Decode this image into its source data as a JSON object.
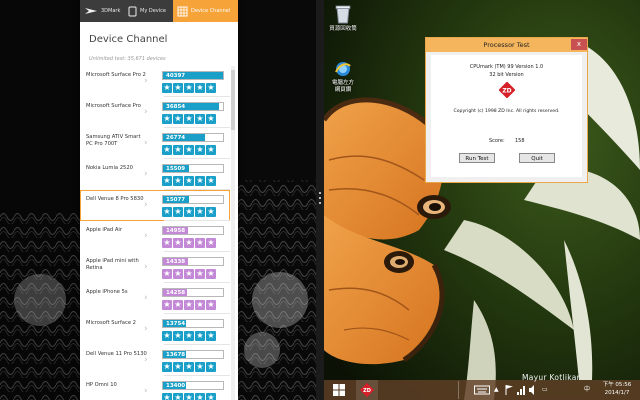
{
  "app": {
    "nav": {
      "brand": "3DMark",
      "my_device": "My Device",
      "device_channel": "Device Channel"
    },
    "panel": {
      "title": "Device Channel",
      "subtitle": "Unlimited test: 35,671 devices"
    },
    "devices": [
      {
        "name": "Microsoft Surface Pro 2",
        "score": "40397",
        "fraction": 1.0,
        "color": "#1aa0c8",
        "stars": 5,
        "star_color": "#1aa0c8"
      },
      {
        "name": "Microsoft Surface Pro",
        "score": "36854",
        "fraction": 0.93,
        "color": "#1aa0c8",
        "stars": 5,
        "star_color": "#1aa0c8"
      },
      {
        "name": "Samsung ATIV Smart PC Pro 700T",
        "score": "26774",
        "fraction": 0.7,
        "color": "#1aa0c8",
        "stars": 5,
        "star_color": "#1aa0c8"
      },
      {
        "name": "Nokia Lumia 2520",
        "score": "15509",
        "fraction": 0.44,
        "color": "#1aa0c8",
        "stars": 5,
        "star_color": "#1aa0c8"
      },
      {
        "name": "Dell Venue 8 Pro 5830",
        "score": "15077",
        "fraction": 0.43,
        "color": "#1aa0c8",
        "stars": 5,
        "star_color": "#1aa0c8"
      },
      {
        "name": "Apple iPad Air",
        "score": "14958",
        "fraction": 0.42,
        "color": "#c389d6",
        "stars": 5,
        "star_color": "#c389d6"
      },
      {
        "name": "Apple iPad mini with Retina",
        "score": "14338",
        "fraction": 0.41,
        "color": "#c389d6",
        "stars": 5,
        "star_color": "#c389d6"
      },
      {
        "name": "Apple iPhone 5s",
        "score": "14258",
        "fraction": 0.4,
        "color": "#c389d6",
        "stars": 5,
        "star_color": "#c389d6"
      },
      {
        "name": "Microsoft Surface 2",
        "score": "13754",
        "fraction": 0.39,
        "color": "#1aa0c8",
        "stars": 5,
        "star_color": "#1aa0c8"
      },
      {
        "name": "Dell Venue 11 Pro 5130",
        "score": "13678",
        "fraction": 0.39,
        "color": "#1aa0c8",
        "stars": 5,
        "star_color": "#1aa0c8"
      },
      {
        "name": "HP Omni 10",
        "score": "13400",
        "fraction": 0.38,
        "color": "#1aa0c8",
        "stars": 5,
        "star_color": "#1aa0c8"
      }
    ],
    "highlight_index": 4
  },
  "desktop": {
    "recycle_bin": "資源回收筒",
    "ie_label": "電腦左方\n網頁鑽"
  },
  "dialog": {
    "title": "Processor Test",
    "close": "x",
    "line1": "CPUmark (TM) 99 Version 1.0",
    "line2": "32 bit Version",
    "logo": "ZD",
    "copyright": "Copyright (c) 1998 ZD Inc. All rights reserved.",
    "score_label": "Score:",
    "score_value": "158",
    "run_button": "Run Test",
    "quit_button": "Quit"
  },
  "taskbar": {
    "zd_label": "ZD",
    "watermark": "Mayur Kotlikar",
    "clock_time": "下午 05:56",
    "clock_date": "2014/1/7",
    "lang": "中"
  },
  "colors": {
    "accent": "#f6a33a",
    "blue_bar": "#1aa0c8",
    "purple_bar": "#c389d6",
    "dialog_title": "#f4b55c"
  }
}
